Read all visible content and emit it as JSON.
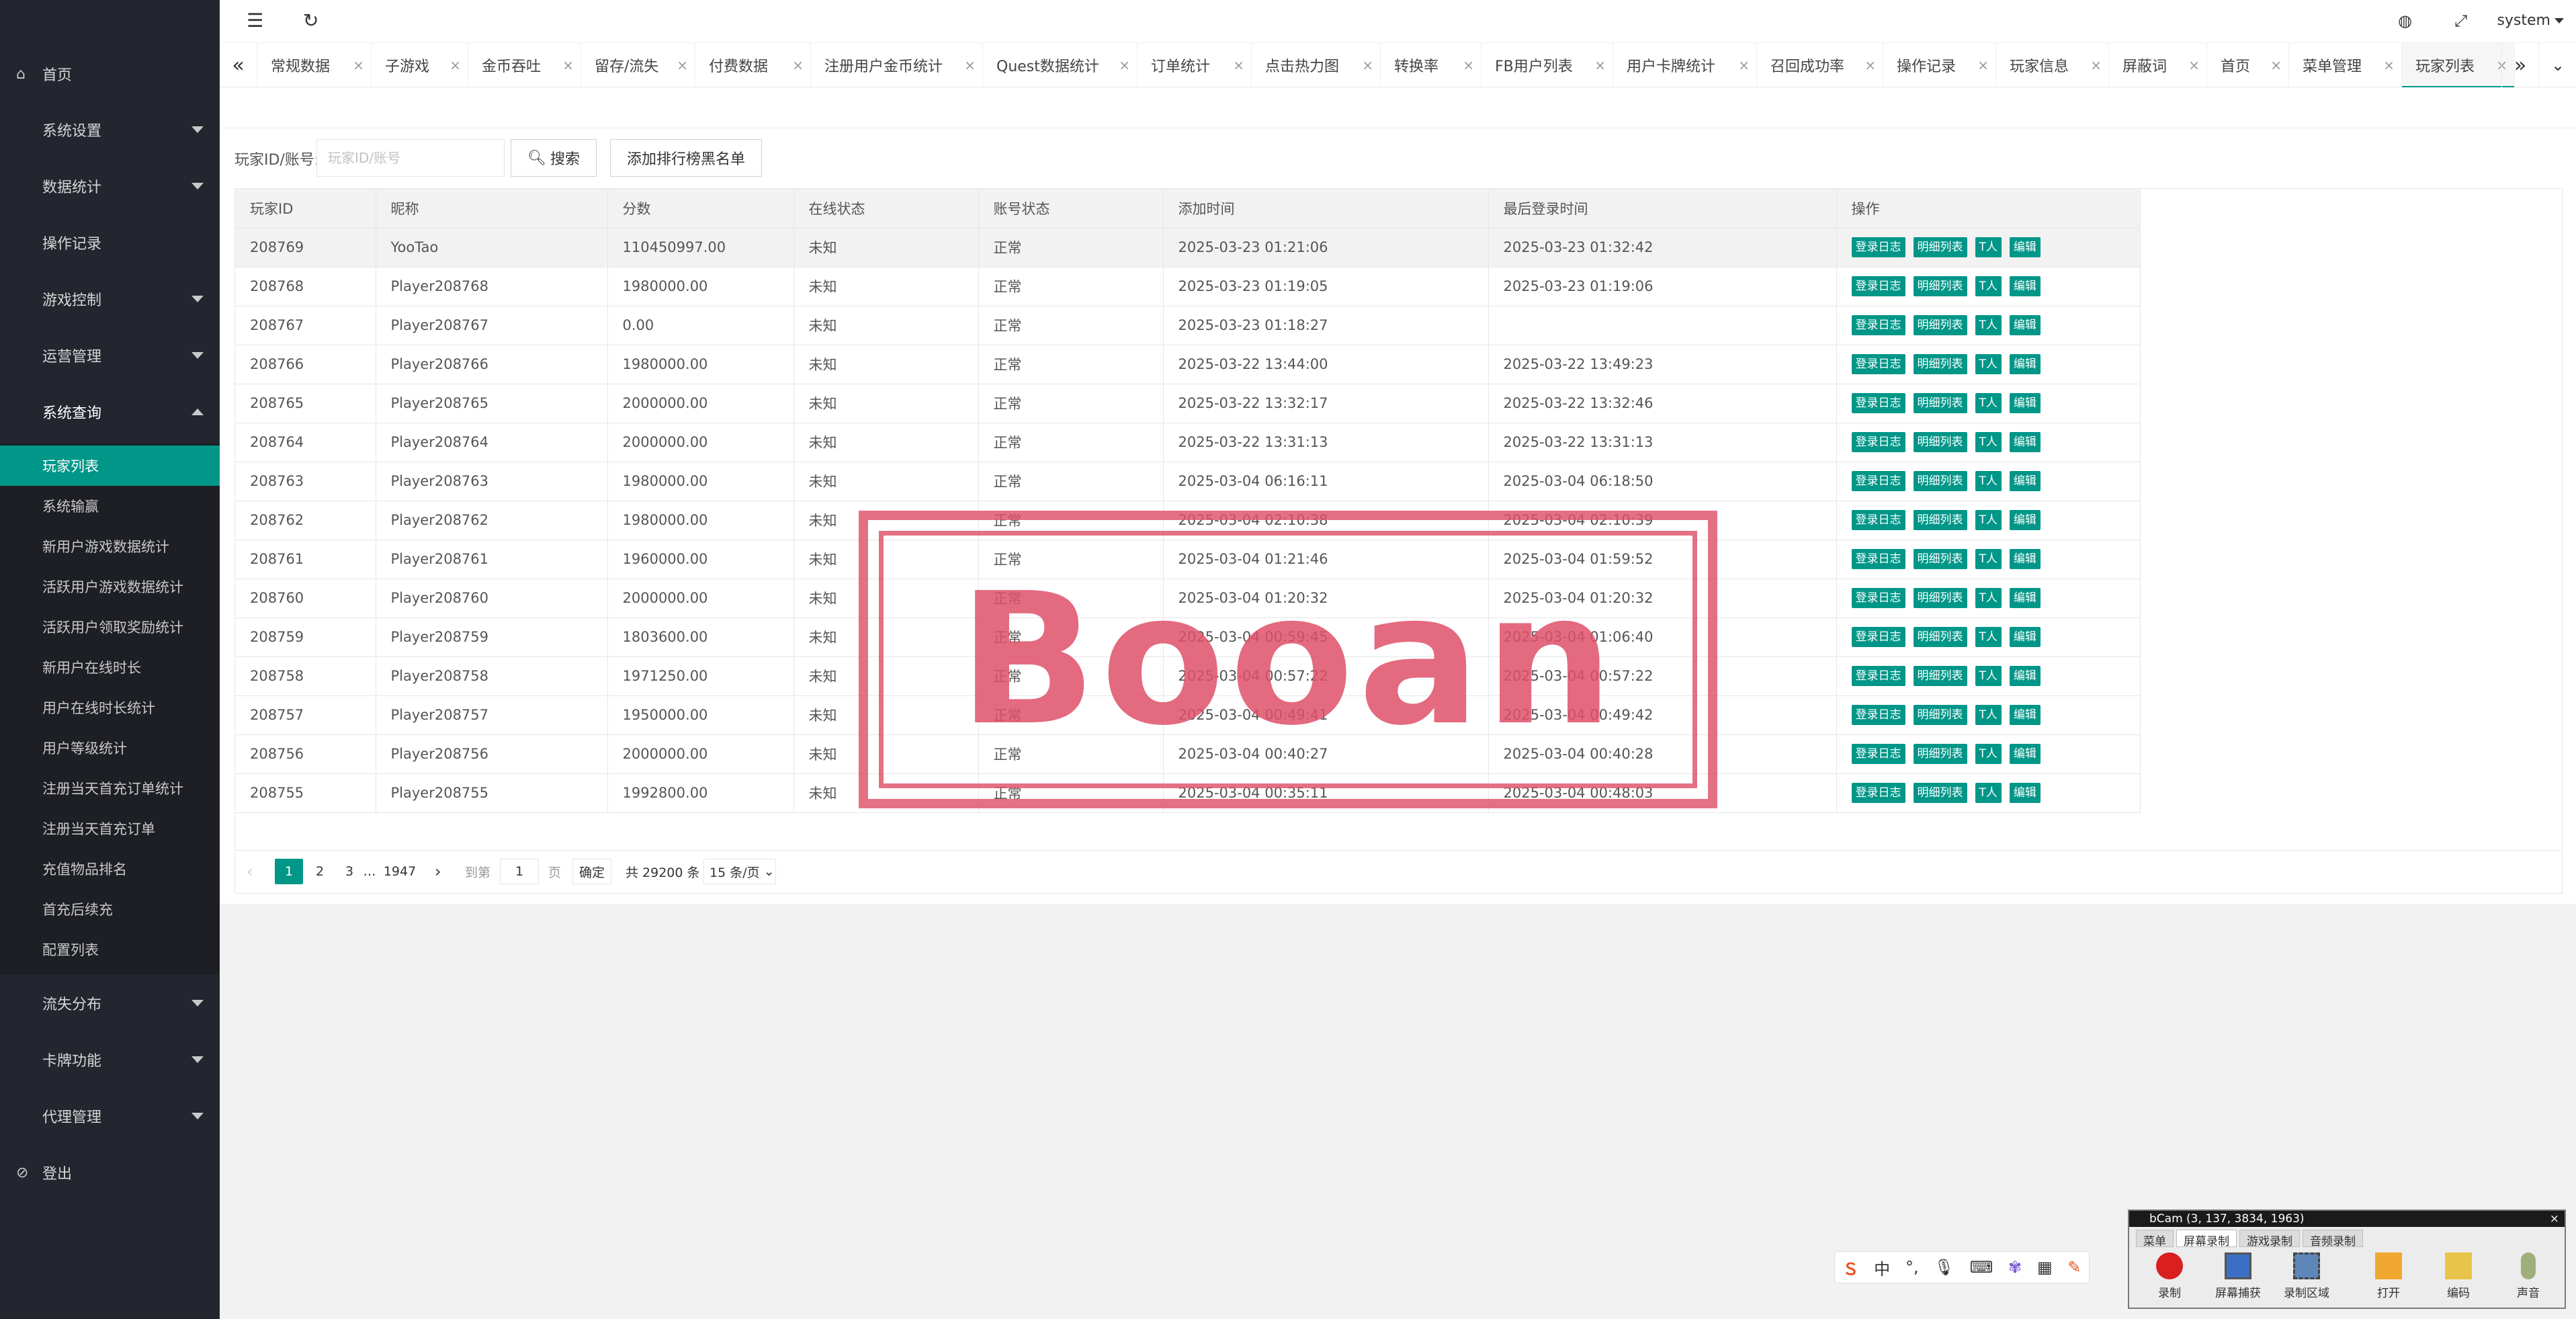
{
  "sidebar": {
    "items": [
      {
        "label": "首页",
        "icon": "home-icon"
      },
      {
        "label": "系统设置"
      },
      {
        "label": "数据统计"
      },
      {
        "label": "操作记录"
      },
      {
        "label": "游戏控制"
      },
      {
        "label": "运营管理"
      },
      {
        "label": "系统查询"
      },
      {
        "label": "流失分布"
      },
      {
        "label": "卡牌功能"
      },
      {
        "label": "代理管理"
      },
      {
        "label": "登出",
        "icon": "logout-icon"
      }
    ],
    "sub_items": [
      "玩家列表",
      "系统输赢",
      "新用户游戏数据统计",
      "活跃用户游戏数据统计",
      "活跃用户领取奖励统计",
      "新用户在线时长",
      "用户在线时长统计",
      "用户等级统计",
      "注册当天首充订单统计",
      "注册当天首充订单",
      "充值物品排名",
      "首充后续充",
      "配置列表"
    ]
  },
  "header": {
    "user": "system"
  },
  "tabs": [
    "常规数据",
    "子游戏",
    "金币吞吐",
    "留存/流失",
    "付费数据",
    "注册用户金币统计",
    "Quest数据统计",
    "订单统计",
    "点击热力图",
    "转换率",
    "FB用户列表",
    "用户卡牌统计",
    "召回成功率",
    "操作记录",
    "玩家信息",
    "屏蔽词",
    "首页",
    "菜单管理",
    "玩家列表"
  ],
  "search": {
    "label": "玩家ID/账号:",
    "placeholder": "玩家ID/账号",
    "search_button": "搜索",
    "blacklist_button": "添加排行榜黑名单"
  },
  "table": {
    "columns": [
      "玩家ID",
      "昵称",
      "分数",
      "在线状态",
      "账号状态",
      "添加时间",
      "最后登录时间",
      "操作"
    ],
    "actions": [
      "登录日志",
      "明细列表",
      "T人",
      "编辑"
    ],
    "rows": [
      [
        "208769",
        "YooTao",
        "110450997.00",
        "未知",
        "正常",
        "2025-03-23 01:21:06",
        "2025-03-23 01:32:42"
      ],
      [
        "208768",
        "Player208768",
        "1980000.00",
        "未知",
        "正常",
        "2025-03-23 01:19:05",
        "2025-03-23 01:19:06"
      ],
      [
        "208767",
        "Player208767",
        "0.00",
        "未知",
        "正常",
        "2025-03-23 01:18:27",
        ""
      ],
      [
        "208766",
        "Player208766",
        "1980000.00",
        "未知",
        "正常",
        "2025-03-22 13:44:00",
        "2025-03-22 13:49:23"
      ],
      [
        "208765",
        "Player208765",
        "2000000.00",
        "未知",
        "正常",
        "2025-03-22 13:32:17",
        "2025-03-22 13:32:46"
      ],
      [
        "208764",
        "Player208764",
        "2000000.00",
        "未知",
        "正常",
        "2025-03-22 13:31:13",
        "2025-03-22 13:31:13"
      ],
      [
        "208763",
        "Player208763",
        "1980000.00",
        "未知",
        "正常",
        "2025-03-04 06:16:11",
        "2025-03-04 06:18:50"
      ],
      [
        "208762",
        "Player208762",
        "1980000.00",
        "未知",
        "正常",
        "2025-03-04 02:10:38",
        "2025-03-04 02:10:39"
      ],
      [
        "208761",
        "Player208761",
        "1960000.00",
        "未知",
        "正常",
        "2025-03-04 01:21:46",
        "2025-03-04 01:59:52"
      ],
      [
        "208760",
        "Player208760",
        "2000000.00",
        "未知",
        "正常",
        "2025-03-04 01:20:32",
        "2025-03-04 01:20:32"
      ],
      [
        "208759",
        "Player208759",
        "1803600.00",
        "未知",
        "正常",
        "2025-03-04 00:59:45",
        "2025-03-04 01:06:40"
      ],
      [
        "208758",
        "Player208758",
        "1971250.00",
        "未知",
        "正常",
        "2025-03-04 00:57:22",
        "2025-03-04 00:57:22"
      ],
      [
        "208757",
        "Player208757",
        "1950000.00",
        "未知",
        "正常",
        "2025-03-04 00:49:41",
        "2025-03-04 00:49:42"
      ],
      [
        "208756",
        "Player208756",
        "2000000.00",
        "未知",
        "正常",
        "2025-03-04 00:40:27",
        "2025-03-04 00:40:28"
      ],
      [
        "208755",
        "Player208755",
        "1992800.00",
        "未知",
        "正常",
        "2025-03-04 00:35:11",
        "2025-03-04 00:48:03"
      ]
    ]
  },
  "pagination": {
    "pages": [
      "1",
      "2",
      "3",
      "…",
      "1947"
    ],
    "goto_label": "到第",
    "goto_value": "1",
    "page_unit": "页",
    "confirm": "确定",
    "total": "共 29200 条",
    "page_size": "15 条/页"
  },
  "watermark": "Booan",
  "recorder": {
    "title": "bCam (3, 137, 3834, 1963)",
    "tabs": [
      "菜单",
      "屏幕录制",
      "游戏录制",
      "音频录制"
    ],
    "tools": [
      "录制",
      "屏幕捕获",
      "录制区域",
      "打开",
      "编码",
      "声音"
    ]
  },
  "ime": {
    "items": [
      "S",
      "中",
      "°,",
      "mic",
      "kbd",
      "skin",
      "grid",
      "tool"
    ]
  },
  "colors": {
    "accent": "#009688",
    "sidebar_bg": "#23262e",
    "stamp": "#de5068"
  }
}
